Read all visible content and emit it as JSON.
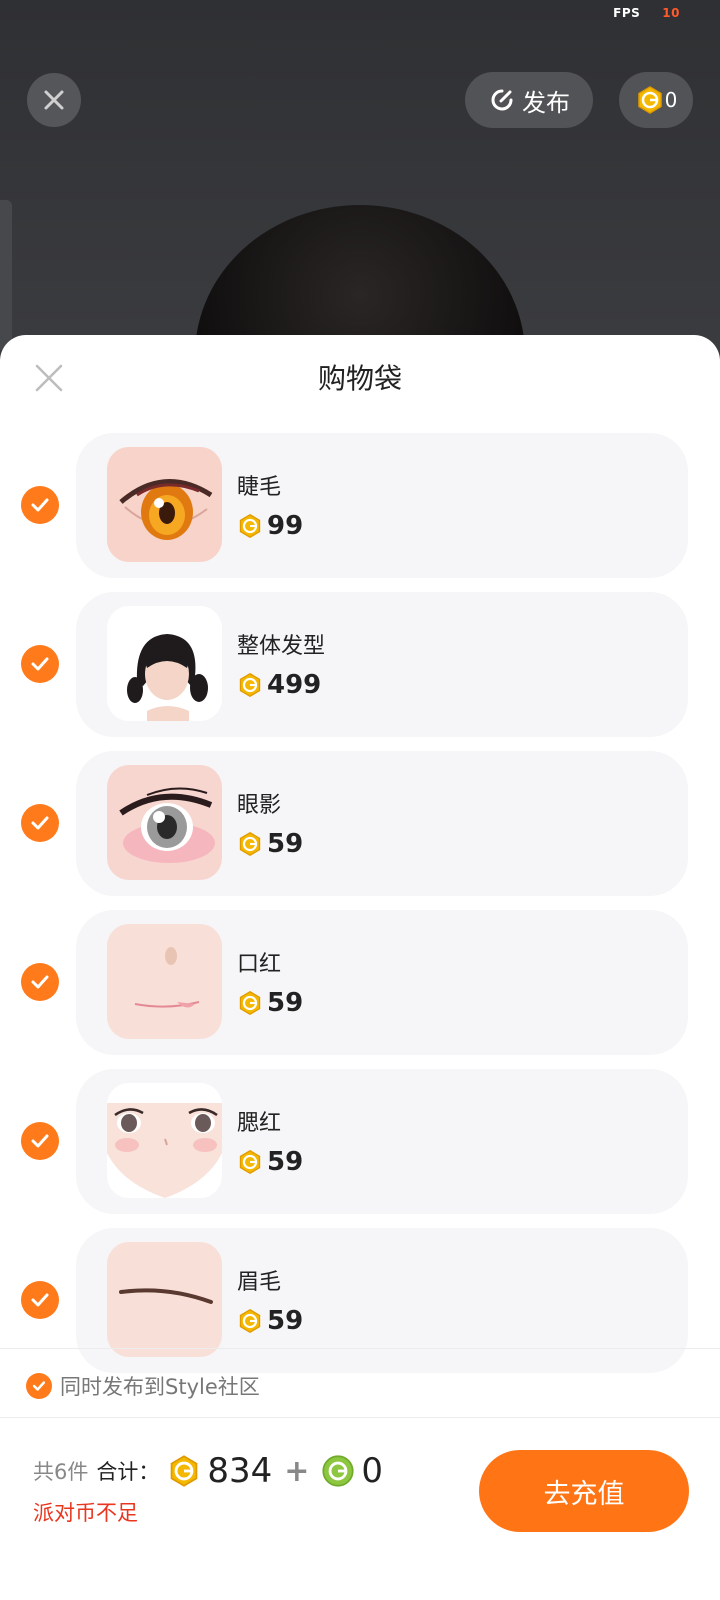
{
  "status": {
    "fps_label": "FPS",
    "fps_value": "10"
  },
  "header": {
    "publish_label": "发布",
    "coin_balance": "0"
  },
  "sheet": {
    "title": "购物袋",
    "items": [
      {
        "name": "睫毛",
        "price": "99",
        "checked": true
      },
      {
        "name": "整体发型",
        "price": "499",
        "checked": true
      },
      {
        "name": "眼影",
        "price": "59",
        "checked": true
      },
      {
        "name": "口红",
        "price": "59",
        "checked": true
      },
      {
        "name": "腮红",
        "price": "59",
        "checked": true
      },
      {
        "name": "眉毛",
        "price": "59",
        "checked": true
      }
    ],
    "community_option": {
      "label": "同时发布到Style社区",
      "checked": true
    },
    "footer": {
      "count_label": "共6件",
      "total_label": "合计：",
      "gold_total": "834",
      "plus": "+",
      "green_total": "0",
      "warning": "派对币不足",
      "recharge_label": "去充值"
    }
  },
  "colors": {
    "accent": "#ff7414",
    "warning": "#e8361f",
    "gold_coin": "#f5b800",
    "green_coin": "#8dc63f"
  }
}
